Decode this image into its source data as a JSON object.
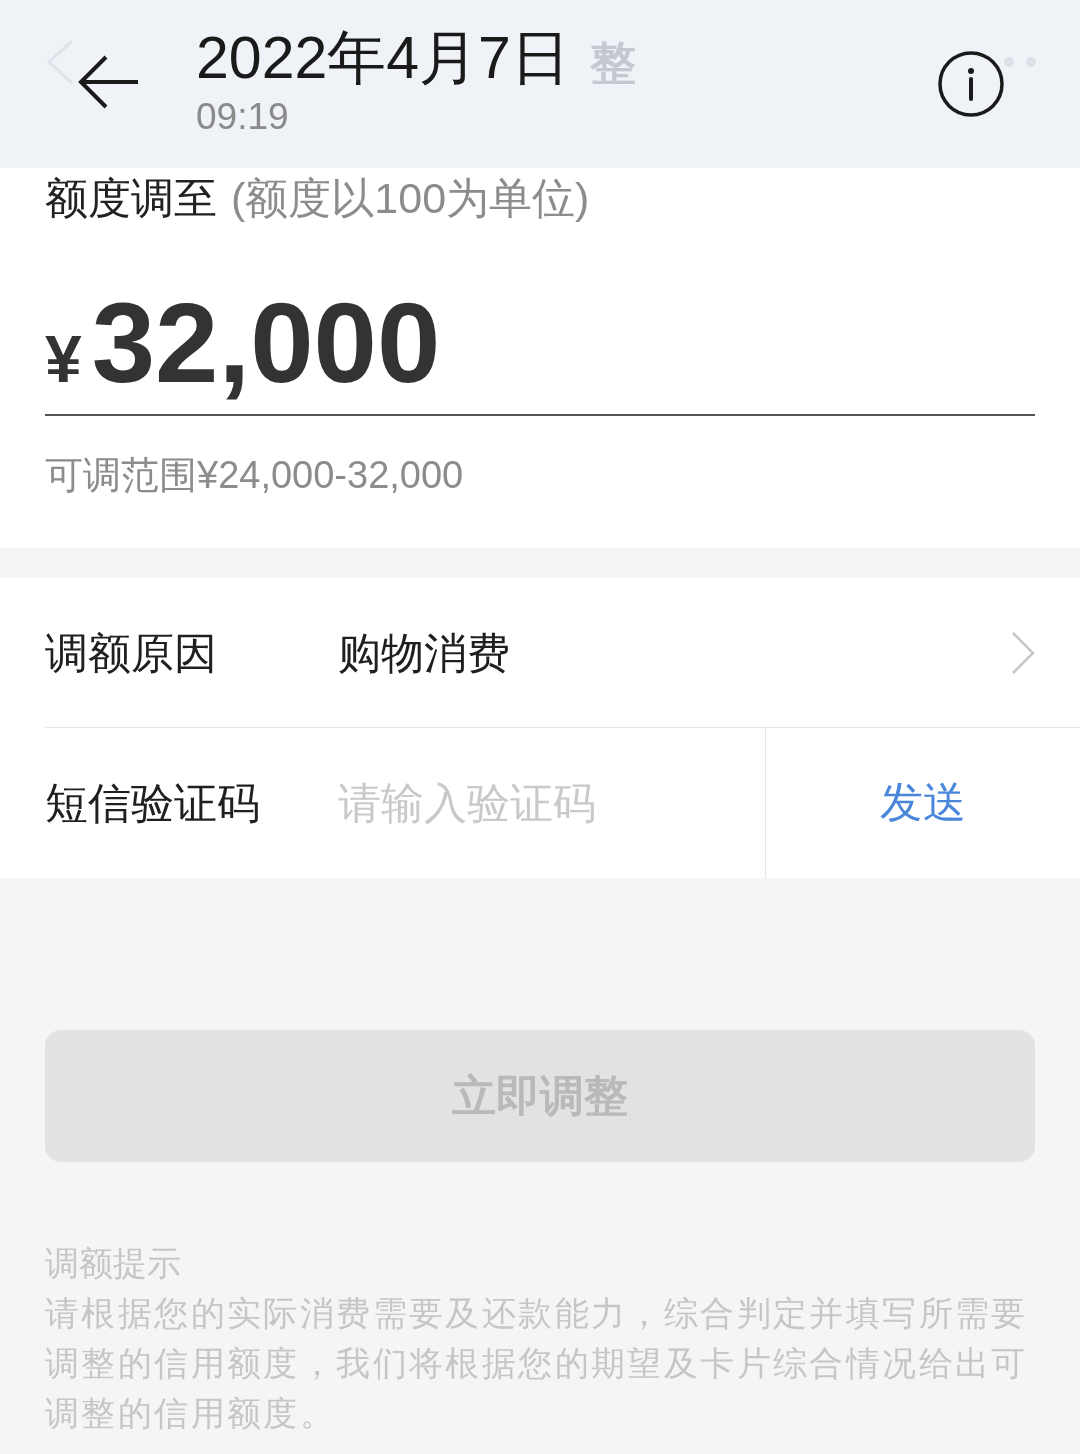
{
  "photo_viewer_bar": {
    "date": "2022年4月7日",
    "time": "09:19"
  },
  "page_behind": {
    "title_fragment": "整"
  },
  "limit_section": {
    "label": "额度调至",
    "hint": "(额度以100为单位)",
    "currency": "¥",
    "amount": "32,000",
    "range": "可调范围¥24,000-32,000"
  },
  "form": {
    "rows": [
      {
        "kind": "select",
        "label": "调额原因",
        "value": "购物消费"
      },
      {
        "kind": "code",
        "label": "短信验证码",
        "placeholder": "请输入验证码",
        "action": "发送"
      }
    ]
  },
  "submit_button": {
    "label": "立即调整",
    "disabled": true
  },
  "tips": {
    "title": "调额提示",
    "text": "请根据您的实际消费需要及还款能力，综合判定并填写所需要调整的信用额度，我们将根据您的期望及卡片综合情况给出可调整的信用额度。"
  }
}
